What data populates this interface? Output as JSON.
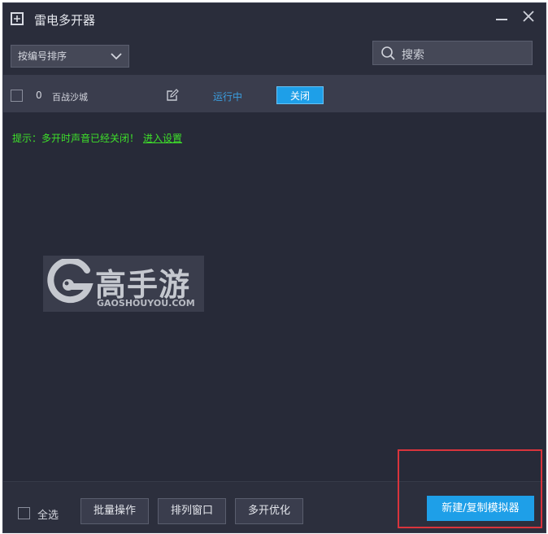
{
  "window": {
    "title": "雷电多开器"
  },
  "toolbar": {
    "sort_label": "按编号排序",
    "search_placeholder": "搜索"
  },
  "instances": [
    {
      "index": "0",
      "name": "百战沙城",
      "status": "运行中",
      "close_label": "关闭"
    }
  ],
  "tip": {
    "text": "提示：多开时声音已经关闭！",
    "link": "进入设置"
  },
  "watermark": {
    "cn": "高手游",
    "en": "GAOSHOUYOU.COM"
  },
  "footer": {
    "select_all": "全选",
    "batch": "批量操作",
    "arrange": "排列窗口",
    "optimize": "多开优化",
    "create": "新建/复制模拟器"
  },
  "colors": {
    "background": "#272a38",
    "accent": "#1e9fe8",
    "status_running": "#3b9ee0",
    "tip_green": "#3ee02a",
    "highlight_red": "#d9343c"
  }
}
